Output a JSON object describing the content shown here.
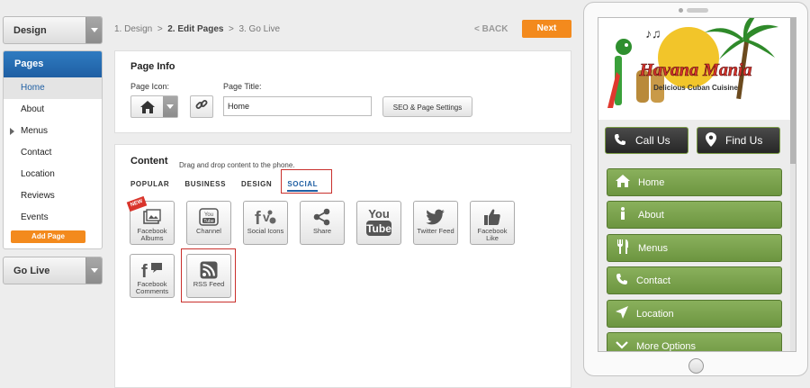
{
  "sidebar": {
    "design_label": "Design",
    "pages_header": "Pages",
    "items": [
      {
        "label": "Home"
      },
      {
        "label": "About"
      },
      {
        "label": "Menus"
      },
      {
        "label": "Contact"
      },
      {
        "label": "Location"
      },
      {
        "label": "Reviews"
      },
      {
        "label": "Events"
      }
    ],
    "add_page_label": "Add Page",
    "golive_label": "Go Live"
  },
  "steps": {
    "step1": "1. Design",
    "sep": ">",
    "step2": "2. Edit Pages",
    "step3": "3. Go Live",
    "back_label": "< BACK",
    "next_label": "Next"
  },
  "page_info": {
    "title": "Page Info",
    "icon_label": "Page Icon:",
    "title_label": "Page Title:",
    "title_value": "Home",
    "seo_label": "SEO & Page Settings"
  },
  "content": {
    "title": "Content",
    "subtitle": "Drag and drop content to the phone.",
    "tabs": [
      {
        "label": "POPULAR"
      },
      {
        "label": "BUSINESS"
      },
      {
        "label": "DESIGN"
      },
      {
        "label": "SOCIAL"
      }
    ],
    "widgets": [
      {
        "label": "Facebook Albums",
        "badge": "NEW"
      },
      {
        "label": "Channel",
        "icon_text": "You Tube"
      },
      {
        "label": "Social Icons"
      },
      {
        "label": "Share"
      },
      {
        "label": "",
        "icon_text": "You Tube"
      },
      {
        "label": "Twitter Feed"
      },
      {
        "label": "Facebook Like"
      },
      {
        "label": "Facebook Comments"
      },
      {
        "label": "RSS Feed"
      }
    ]
  },
  "phone": {
    "logo_title": "Havana Mania",
    "logo_tagline": "Delicious Cuban Cuisine",
    "call_label": "Call Us",
    "find_label": "Find Us",
    "menu": [
      {
        "label": "Home"
      },
      {
        "label": "About"
      },
      {
        "label": "Menus"
      },
      {
        "label": "Contact"
      },
      {
        "label": "Location"
      },
      {
        "label": "More Options"
      }
    ]
  },
  "colors": {
    "accent": "#f38a1d",
    "primary": "#1f5fa3",
    "highlight": "#c9302c",
    "phone_button": "#7aa24d"
  }
}
